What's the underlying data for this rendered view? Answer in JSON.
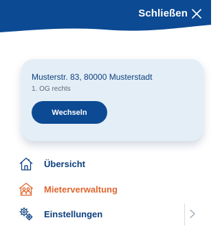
{
  "colors": {
    "brand_blue": "#0c4a93",
    "text_blue": "#0c3f7f",
    "active_orange": "#e0662f",
    "card_bg": "#e4eef6"
  },
  "header": {
    "close_label": "Schließen",
    "close_icon": "close-icon"
  },
  "address_card": {
    "address": "Musterstr. 83, 80000 Musterstadt",
    "floor": "1. OG rechts",
    "switch_label": "Wechseln"
  },
  "nav": {
    "items": [
      {
        "label": "Übersicht",
        "icon": "house-icon",
        "active": false
      },
      {
        "label": "Mieterverwaltung",
        "icon": "tenants-icon",
        "active": true
      },
      {
        "label": "Einstellungen",
        "icon": "gears-icon",
        "active": false,
        "expandable": true
      }
    ]
  }
}
